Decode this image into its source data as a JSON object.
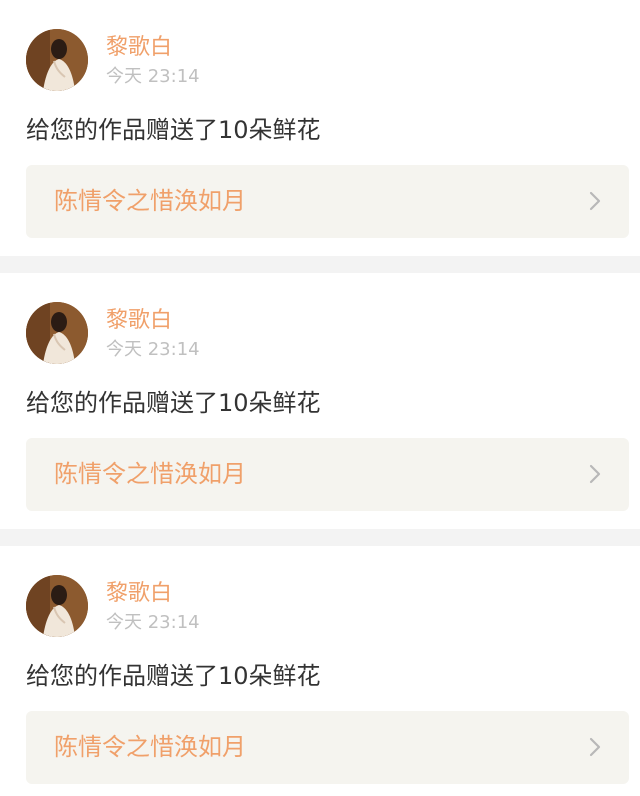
{
  "feed": {
    "items": [
      {
        "username": "黎歌白",
        "timestamp": "今天 23:14",
        "message": "给您的作品赠送了10朵鲜花",
        "work_title": "陈情令之惜涣如月",
        "avatar_icon": "avatar-image",
        "chevron_icon": "chevron-right-icon"
      },
      {
        "username": "黎歌白",
        "timestamp": "今天 23:14",
        "message": "给您的作品赠送了10朵鲜花",
        "work_title": "陈情令之惜涣如月",
        "avatar_icon": "avatar-image",
        "chevron_icon": "chevron-right-icon"
      },
      {
        "username": "黎歌白",
        "timestamp": "今天 23:14",
        "message": "给您的作品赠送了10朵鲜花",
        "work_title": "陈情令之惜涣如月",
        "avatar_icon": "avatar-image",
        "chevron_icon": "chevron-right-icon"
      }
    ]
  },
  "theme": {
    "accent": "#f0a06a",
    "text": "#333333",
    "muted": "#c0c0c0",
    "separator": "#f3f3f3",
    "link_bg": "#f5f4ef"
  }
}
